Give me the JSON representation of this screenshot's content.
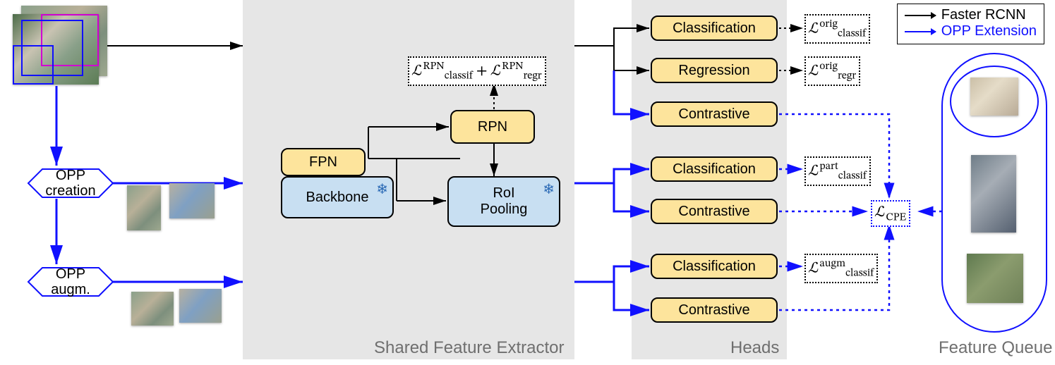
{
  "legend": {
    "row1": "Faster RCNN",
    "row2": "OPP Extension"
  },
  "regions": {
    "feature_extractor": "Shared Feature Extractor",
    "heads": "Heads",
    "feature_queue": "Feature Queue"
  },
  "nodes": {
    "opp_creation": "OPP\ncreation",
    "opp_augm": "OPP\naugm.",
    "fpn": "FPN",
    "backbone": "Backbone",
    "rpn": "RPN",
    "roi": "RoI\nPooling"
  },
  "heads": {
    "h1": "Classification",
    "h2": "Regression",
    "h3": "Contrastive",
    "h4": "Classification",
    "h5": "Contrastive",
    "h6": "Classification",
    "h7": "Contrastive"
  },
  "losses": {
    "rpn": "ℒ<span class='sup'>RPN</span><span class='sub'>classif</span> + ℒ<span class='sup'>RPN</span><span class='sub'>regr</span>",
    "orig_classif": "ℒ<span class='sup'>orig</span><span class='sub'>classif</span>",
    "orig_regr": "ℒ<span class='sup'>orig</span><span class='sub'>regr</span>",
    "part_classif": "ℒ<span class='sup'>part</span><span class='sub'>classif</span>",
    "augm_classif": "ℒ<span class='sup'>augm</span><span class='sub'>classif</span>",
    "cpe": "ℒ<span class='sub'>CPE</span>"
  },
  "colors": {
    "blue": "#1010ff",
    "black": "#000000"
  }
}
